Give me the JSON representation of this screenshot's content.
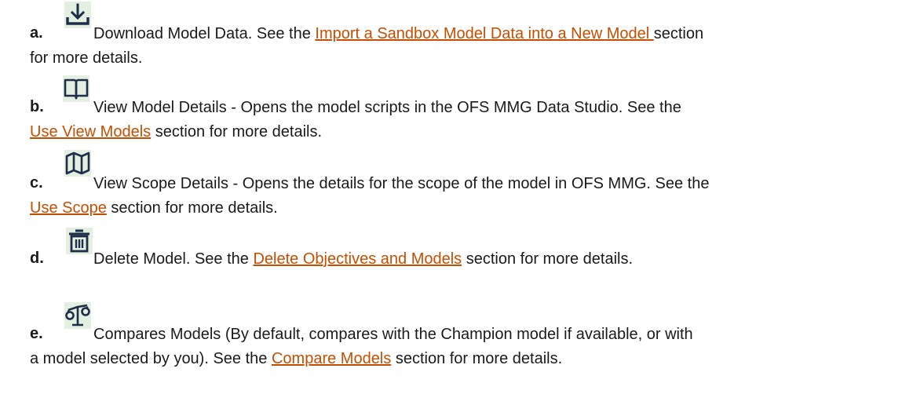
{
  "items": [
    {
      "letter": "a.",
      "icon": "download-icon",
      "line1_before": "Download Model Data. See the ",
      "link": "Import a Sandbox Model Data into a New Model ",
      "line1_after": "section",
      "line2": "for more details."
    },
    {
      "letter": "b.",
      "icon": "open-book-icon",
      "line1": "View Model Details - Opens the model scripts in the OFS MMG Data Studio. See the",
      "link": "Use View Models",
      "line2_after": " section for more details."
    },
    {
      "letter": "c.",
      "icon": "map-icon",
      "line1": "View Scope Details - Opens the details for the scope of the model in OFS MMG. See the",
      "link": "Use Scope",
      "line2_after": " section for more details."
    },
    {
      "letter": "d.",
      "icon": "trash-icon",
      "line1_before": "Delete Model. See the ",
      "link": "Delete Objectives and Models",
      "line1_after": " section for more details."
    },
    {
      "letter": "e.",
      "icon": "compare-icon",
      "line1": "Compares Models (By default, compares with the Champion model if available, or with",
      "line2_before": "a model selected by you). See the ",
      "link": "Compare Models",
      "line2_after": " section for more details."
    }
  ],
  "colors": {
    "link": "#c74e00",
    "icon_bg": "#e3efe0",
    "icon_fg": "#1e2d4a"
  }
}
